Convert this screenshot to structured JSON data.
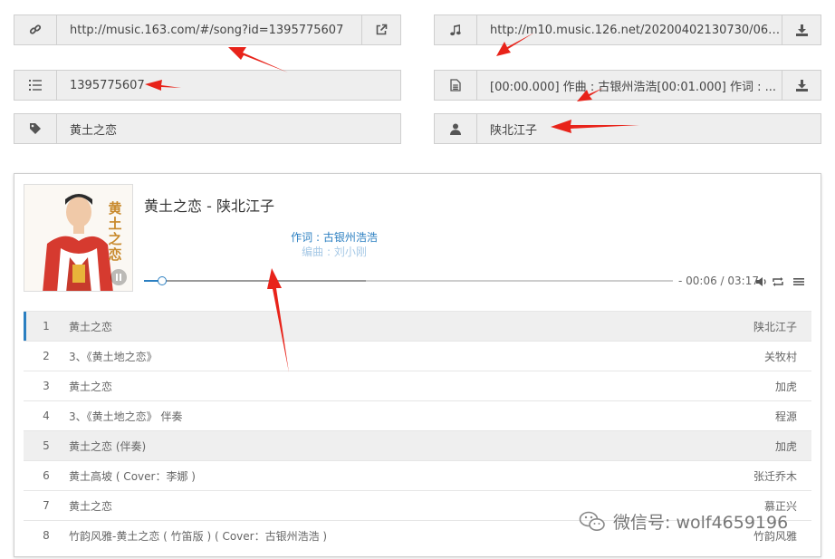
{
  "fields": {
    "song_url": "http://music.163.com/#/song?id=1395775607",
    "song_id": "1395775607",
    "song_name": "黄土之恋",
    "mp3_url": "http://m10.music.126.net/20200402130730/068...",
    "lyric": "[00:00.000] 作曲 : 古银州浩浩[00:01.000] 作词 : ...",
    "artist": "陕北江子"
  },
  "player": {
    "title": "黄土之恋 - 陕北江子",
    "cover_title": "黄土之恋",
    "lyric_current": "作词 : 古银州浩浩",
    "lyric_next": "编曲 : 刘小刚",
    "time": "- 00:06 / 03:17",
    "progress": 0.032,
    "buffered": 0.42
  },
  "playlist": [
    {
      "num": "1",
      "name": "黄土之恋",
      "artist": "陕北江子"
    },
    {
      "num": "2",
      "name": "3、《黄土地之恋》",
      "artist": "关牧村"
    },
    {
      "num": "3",
      "name": "黄土之恋",
      "artist": "加虎"
    },
    {
      "num": "4",
      "name": "3、《黄土地之恋》 伴奏",
      "artist": "程源"
    },
    {
      "num": "5",
      "name": "黄土之恋 (伴奏)",
      "artist": "加虎"
    },
    {
      "num": "6",
      "name": "黄土高坡 ( Cover：李娜 )",
      "artist": "张迁乔木"
    },
    {
      "num": "7",
      "name": "黄土之恋",
      "artist": "慕正兴"
    },
    {
      "num": "8",
      "name": "竹韵风雅-黄土之恋 ( 竹笛版 ) ( Cover：古银州浩浩 )",
      "artist": "竹韵风雅"
    }
  ],
  "watermark": "微信号: wolf4659196",
  "colors": {
    "accent": "#2b7fc1",
    "arrow": "#e8231a"
  }
}
